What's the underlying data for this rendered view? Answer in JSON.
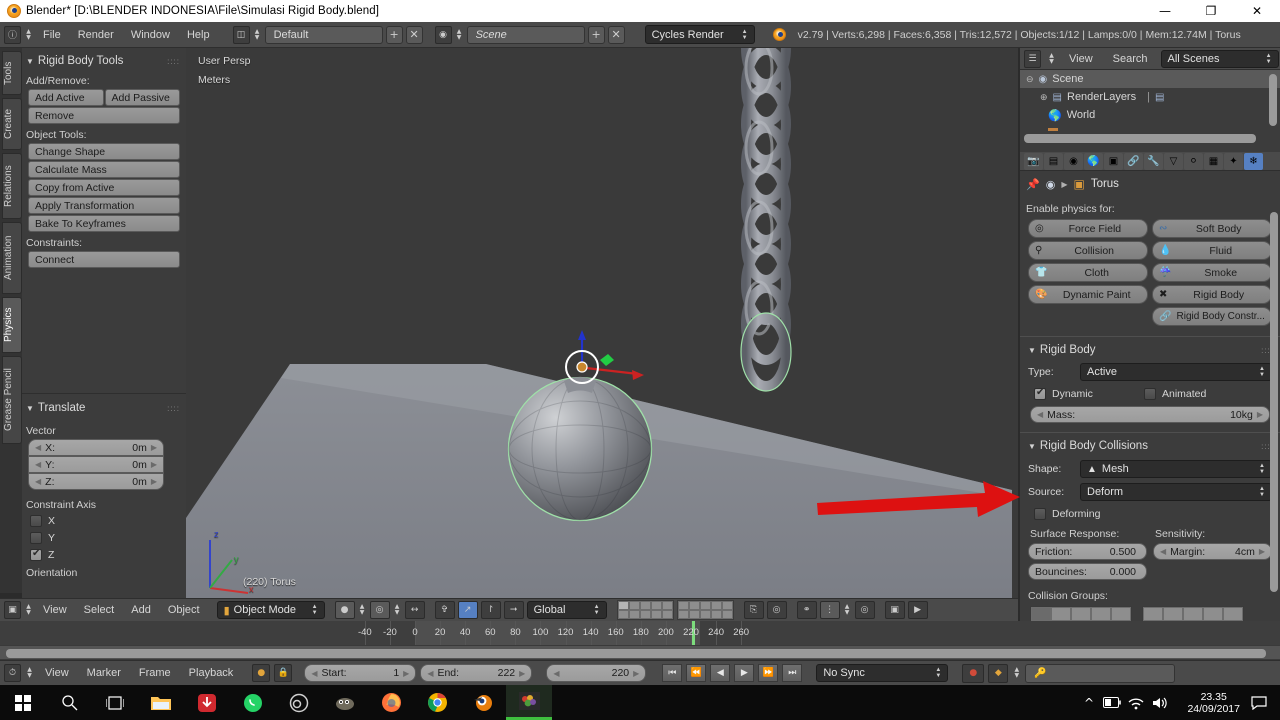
{
  "window": {
    "title": "Blender* [D:\\BLENDER INDONESIA\\File\\Simulasi Rigid Body.blend]",
    "minimize": "—",
    "maximize": "❐",
    "close": "✕"
  },
  "topbar": {
    "menus": [
      "File",
      "Render",
      "Window",
      "Help"
    ],
    "screen_layout": "Default",
    "scene_name": "Scene",
    "engine": "Cycles Render",
    "status": "v2.79 | Verts:6,298 | Faces:6,358 | Tris:12,572 | Objects:1/12 | Lamps:0/0 | Mem:12.74M | Torus",
    "add_label": "+",
    "remove_label": "✕"
  },
  "toolshelf": {
    "tabs": [
      "Tools",
      "Create",
      "Relations",
      "Animation",
      "Physics",
      "Grease Pencil"
    ],
    "active_tab": "Physics",
    "rigid_body_tools": {
      "title": "Rigid Body Tools",
      "add_remove_label": "Add/Remove:",
      "add_active": "Add Active",
      "add_passive": "Add Passive",
      "remove": "Remove",
      "object_tools_label": "Object Tools:",
      "object_tools": [
        "Change Shape",
        "Calculate Mass",
        "Copy from Active",
        "Apply Transformation",
        "Bake To Keyframes"
      ],
      "constraints_label": "Constraints:",
      "connect": "Connect"
    },
    "translate_panel": {
      "title": "Translate",
      "vector_label": "Vector",
      "vector": [
        {
          "axis": "X:",
          "value": "0m"
        },
        {
          "axis": "Y:",
          "value": "0m"
        },
        {
          "axis": "Z:",
          "value": "0m"
        }
      ],
      "constraint_axis_label": "Constraint Axis",
      "axes": [
        {
          "label": "X",
          "checked": false
        },
        {
          "label": "Y",
          "checked": false
        },
        {
          "label": "Z",
          "checked": true
        }
      ],
      "orientation_label": "Orientation"
    }
  },
  "viewport": {
    "view_mode": "User Persp",
    "units": "Meters",
    "object_info": "(220) Torus",
    "axis_gizmo": {
      "z": "z",
      "y": "y",
      "x": "x"
    }
  },
  "viewport_header": {
    "menus": [
      "View",
      "Select",
      "Add",
      "Object"
    ],
    "mode": "Object Mode",
    "transform_orientation": "Global"
  },
  "outliner": {
    "menus": [
      "View",
      "Search"
    ],
    "display_mode": "All Scenes",
    "items": [
      {
        "label": "Scene",
        "indent": 0
      },
      {
        "label": "RenderLayers",
        "indent": 1
      },
      {
        "label": "World",
        "indent": 1
      }
    ]
  },
  "properties": {
    "breadcrumb": "Torus",
    "enable_physics_label": "Enable physics for:",
    "physics_buttons_left": [
      "Force Field",
      "Collision",
      "Cloth",
      "Dynamic Paint"
    ],
    "physics_buttons_right": [
      "Soft Body",
      "Fluid",
      "Smoke",
      "Rigid Body"
    ],
    "rigid_body_constraint": "Rigid Body Constr...",
    "rigid_body": {
      "title": "Rigid Body",
      "type_label": "Type:",
      "type_value": "Active",
      "dynamic_label": "Dynamic",
      "dynamic_checked": true,
      "animated_label": "Animated",
      "animated_checked": false,
      "mass_label": "Mass:",
      "mass_value": "10kg"
    },
    "rigid_body_collisions": {
      "title": "Rigid Body Collisions",
      "shape_label": "Shape:",
      "shape_value": "Mesh",
      "source_label": "Source:",
      "source_value": "Deform",
      "deforming_label": "Deforming",
      "deforming_checked": false,
      "surface_response_label": "Surface Response:",
      "sensitivity_label": "Sensitivity:",
      "friction_label": "Friction:",
      "friction_value": "0.500",
      "margin_label": "Margin:",
      "margin_value": "4cm",
      "bounciness_label": "Bouncines:",
      "bounciness_value": "0.000",
      "collision_groups_label": "Collision Groups:"
    }
  },
  "timeline": {
    "menus": [
      "View",
      "Marker",
      "Frame",
      "Playback"
    ],
    "start_label": "Start:",
    "start_value": "1",
    "end_label": "End:",
    "end_value": "222",
    "current_frame": "220",
    "sync_mode": "No Sync",
    "ticks": [
      -40,
      -20,
      0,
      20,
      40,
      60,
      80,
      100,
      120,
      140,
      160,
      180,
      200,
      220,
      240,
      260
    ]
  },
  "taskbar": {
    "items": [
      "start-icon",
      "search-icon",
      "task-view-icon",
      "file-explorer-icon",
      "download-icon",
      "whatsapp-icon",
      "obs-icon",
      "gimp-icon",
      "firefox-icon",
      "chrome-icon",
      "blender-icon",
      "photos-icon"
    ],
    "clock_time": "23.35",
    "clock_date": "24/09/2017"
  },
  "colors": {
    "accent_blue": "#5680c2",
    "annotation_red": "#dd1111",
    "header_grey": "#4a4a4a",
    "panel_grey": "#3c3c3c"
  }
}
